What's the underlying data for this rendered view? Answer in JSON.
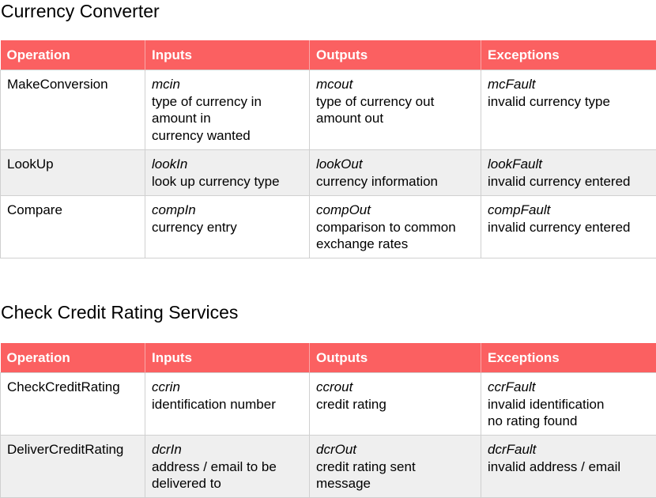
{
  "colors": {
    "header_background": "#fb6061",
    "header_text": "#ffffff",
    "alt_row_background": "#efefef",
    "border": "#d0d0d0"
  },
  "sections": [
    {
      "title": "Currency Converter",
      "headers": [
        "Operation",
        "Inputs",
        "Outputs",
        "Exceptions"
      ],
      "rows": [
        {
          "operation": "MakeConversion",
          "inputs": {
            "name": "mcin",
            "lines": [
              "type of currency in",
              "amount in",
              "currency wanted"
            ]
          },
          "outputs": {
            "name": "mcout",
            "lines": [
              "type of currency out",
              "amount out"
            ]
          },
          "exceptions": {
            "name": "mcFault",
            "lines": [
              "invalid currency type"
            ]
          }
        },
        {
          "operation": "LookUp",
          "inputs": {
            "name": "lookIn",
            "lines": [
              "look up currency type"
            ]
          },
          "outputs": {
            "name": "lookOut",
            "lines": [
              "currency information"
            ]
          },
          "exceptions": {
            "name": "lookFault",
            "lines": [
              "invalid currency entered"
            ]
          }
        },
        {
          "operation": "Compare",
          "inputs": {
            "name": "compIn",
            "lines": [
              "currency entry"
            ]
          },
          "outputs": {
            "name": "compOut",
            "lines": [
              "comparison to common",
              "exchange rates"
            ]
          },
          "exceptions": {
            "name": "compFault",
            "lines": [
              "invalid currency entered"
            ]
          }
        }
      ]
    },
    {
      "title": "Check Credit Rating Services",
      "headers": [
        "Operation",
        "Inputs",
        "Outputs",
        "Exceptions"
      ],
      "rows": [
        {
          "operation": "CheckCreditRating",
          "inputs": {
            "name": "ccrin",
            "lines": [
              "identification number"
            ]
          },
          "outputs": {
            "name": "ccrout",
            "lines": [
              "credit rating"
            ]
          },
          "exceptions": {
            "name": "ccrFault",
            "lines": [
              "invalid identification",
              "no rating found"
            ]
          }
        },
        {
          "operation": "DeliverCreditRating",
          "inputs": {
            "name": "dcrIn",
            "lines": [
              "address / email to be",
              "delivered to"
            ]
          },
          "outputs": {
            "name": "dcrOut",
            "lines": [
              "credit rating sent",
              "message"
            ]
          },
          "exceptions": {
            "name": "dcrFault",
            "lines": [
              "invalid address / email"
            ]
          }
        }
      ]
    }
  ]
}
